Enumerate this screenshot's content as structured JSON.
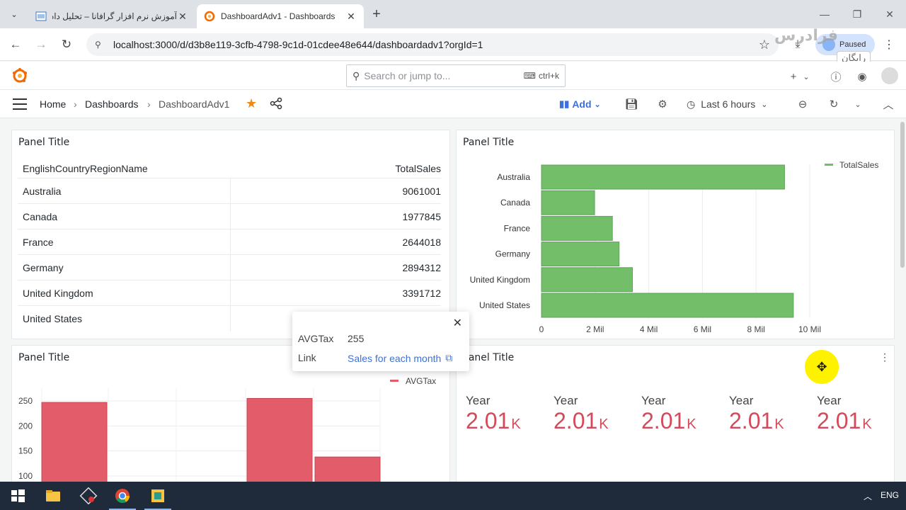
{
  "browser": {
    "tabs": [
      {
        "title": "آموزش نرم افزار گرافانا – تحلیل داده",
        "active": false
      },
      {
        "title": "DashboardAdv1 - Dashboards",
        "active": true
      }
    ],
    "url": "localhost:3000/d/d3b8e119-3cfb-4798-9c1d-01cdee48e644/dashboardadv1?orgId=1",
    "profile_label": "Paused",
    "watermark_brand": "فرادرس",
    "watermark_free": "رایگان"
  },
  "grafana": {
    "search_placeholder": "Search or jump to...",
    "search_shortcut": "ctrl+k",
    "breadcrumb": [
      "Home",
      "Dashboards",
      "DashboardAdv1"
    ],
    "add_label": "Add",
    "time_range": "Last 6 hours"
  },
  "panels": {
    "table": {
      "title": "Panel Title",
      "columns": [
        "EnglishCountryRegionName",
        "TotalSales"
      ],
      "rows": [
        [
          "Australia",
          "9061001"
        ],
        [
          "Canada",
          "1977845"
        ],
        [
          "France",
          "2644018"
        ],
        [
          "Germany",
          "2894312"
        ],
        [
          "United Kingdom",
          "3391712"
        ],
        [
          "United States",
          ""
        ]
      ]
    },
    "bar": {
      "title": "Panel Title"
    },
    "tax": {
      "title": "Panel Title"
    },
    "stat": {
      "title": "Panel Title",
      "items": [
        {
          "label": "Year",
          "value": "2.01",
          "unit": "K"
        },
        {
          "label": "Year",
          "value": "2.01",
          "unit": "K"
        },
        {
          "label": "Year",
          "value": "2.01",
          "unit": "K"
        },
        {
          "label": "Year",
          "value": "2.01",
          "unit": "K"
        },
        {
          "label": "Year",
          "value": "2.01",
          "unit": "K"
        }
      ]
    }
  },
  "tooltip": {
    "rows": [
      {
        "label": "AVGTax",
        "value": "255"
      },
      {
        "label": "Link",
        "value": "Sales for each month"
      }
    ]
  },
  "taskbar": {
    "language": "ENG"
  },
  "chart_data": [
    {
      "type": "bar",
      "orientation": "horizontal",
      "categories": [
        "Australia",
        "Canada",
        "France",
        "Germany",
        "United Kingdom",
        "United States"
      ],
      "series": [
        {
          "name": "TotalSales",
          "values": [
            9061001,
            1977845,
            2644018,
            2894312,
            3391712,
            9390000
          ],
          "color": "#73bf69"
        }
      ],
      "xticks": [
        "0",
        "2 Mil",
        "4 Mil",
        "6 Mil",
        "8 Mil",
        "10 Mil"
      ],
      "xlim": [
        0,
        10000000
      ],
      "legend": "top-right",
      "grid": true
    },
    {
      "type": "bar",
      "series": [
        {
          "name": "AVGTax",
          "values": [
            247,
            0,
            0,
            255,
            138
          ],
          "color": "#e35c6a"
        }
      ],
      "yticks": [
        "100",
        "150",
        "200",
        "250"
      ],
      "ylim": [
        85,
        270
      ],
      "legend": "top-right",
      "grid": true
    }
  ]
}
